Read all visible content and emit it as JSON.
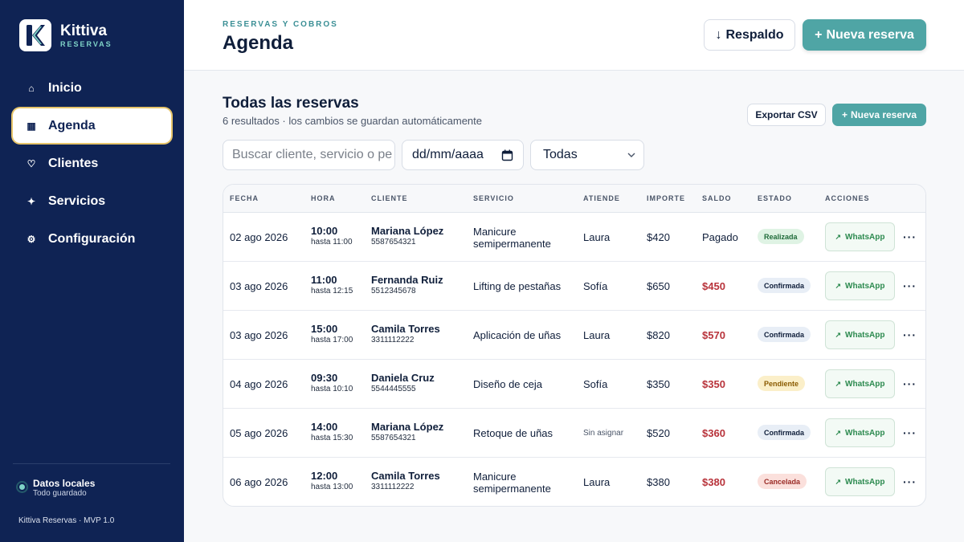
{
  "brand": {
    "name": "Kittiva",
    "sub": "RESERVAS",
    "logo_letter": "K"
  },
  "nav": [
    {
      "label": "Inicio",
      "icon": "home-icon",
      "glyph": "⌂",
      "active": false
    },
    {
      "label": "Agenda",
      "icon": "calendar-grid-icon",
      "glyph": "▦",
      "active": true
    },
    {
      "label": "Clientes",
      "icon": "heart-icon",
      "glyph": "♡",
      "active": false
    },
    {
      "label": "Servicios",
      "icon": "sparkle-icon",
      "glyph": "✦",
      "active": false
    },
    {
      "label": "Configuración",
      "icon": "gear-icon",
      "glyph": "⚙",
      "active": false
    }
  ],
  "local": {
    "title": "Datos locales",
    "sub": "Todo guardado"
  },
  "version": "Kittiva Reservas · MVP 1.0",
  "header": {
    "crumb": "RESERVAS Y COBROS",
    "title": "Agenda",
    "backup_label": "Respaldo",
    "new_label": "Nueva reserva"
  },
  "section": {
    "title": "Todas las reservas",
    "sub": "6 resultados · los cambios se guardan automáticamente",
    "export_label": "Exportar CSV",
    "new_label": "Nueva reserva"
  },
  "filters": {
    "search_placeholder": "Buscar cliente, servicio o pe",
    "date_placeholder": "dd/mm/aaaa",
    "status_value": "Todas"
  },
  "columns": [
    "FECHA",
    "HORA",
    "CLIENTE",
    "SERVICIO",
    "ATIENDE",
    "IMPORTE",
    "SALDO",
    "ESTADO",
    "ACCIONES"
  ],
  "rows": [
    {
      "fecha": "02 ago 2026",
      "hora": "10:00",
      "hasta": "hasta 11:00",
      "cliente": "Mariana López",
      "tel": "5587654321",
      "servicio": "Manicure semipermanente",
      "atiende": "Laura",
      "importe": "$420",
      "saldo": "Pagado",
      "saldo_pendiente": false,
      "estado": "Realizada",
      "estado_tipo": "done",
      "accion": "WhatsApp"
    },
    {
      "fecha": "03 ago 2026",
      "hora": "11:00",
      "hasta": "hasta 12:15",
      "cliente": "Fernanda Ruiz",
      "tel": "5512345678",
      "servicio": "Lifting de pestañas",
      "atiende": "Sofía",
      "importe": "$650",
      "saldo": "$450",
      "saldo_pendiente": true,
      "estado": "Confirmada",
      "estado_tipo": "confirmed",
      "accion": "WhatsApp"
    },
    {
      "fecha": "03 ago 2026",
      "hora": "15:00",
      "hasta": "hasta 17:00",
      "cliente": "Camila Torres",
      "tel": "3311112222",
      "servicio": "Aplicación de uñas",
      "atiende": "Laura",
      "importe": "$820",
      "saldo": "$570",
      "saldo_pendiente": true,
      "estado": "Confirmada",
      "estado_tipo": "confirmed",
      "accion": "WhatsApp"
    },
    {
      "fecha": "04 ago 2026",
      "hora": "09:30",
      "hasta": "hasta 10:10",
      "cliente": "Daniela Cruz",
      "tel": "5544445555",
      "servicio": "Diseño de ceja",
      "atiende": "Sofía",
      "importe": "$350",
      "saldo": "$350",
      "saldo_pendiente": true,
      "estado": "Pendiente",
      "estado_tipo": "pending",
      "accion": "WhatsApp"
    },
    {
      "fecha": "05 ago 2026",
      "hora": "14:00",
      "hasta": "hasta 15:30",
      "cliente": "Mariana López",
      "tel": "5587654321",
      "servicio": "Retoque de uñas",
      "atiende": "Sin asignar",
      "atiende_vacio": true,
      "importe": "$520",
      "saldo": "$360",
      "saldo_pendiente": true,
      "estado": "Confirmada",
      "estado_tipo": "confirmed",
      "accion": "WhatsApp"
    },
    {
      "fecha": "06 ago 2026",
      "hora": "12:00",
      "hasta": "hasta 13:00",
      "cliente": "Camila Torres",
      "tel": "3311112222",
      "servicio": "Manicure semipermanente",
      "atiende": "Laura",
      "importe": "$380",
      "saldo": "$380",
      "saldo_pendiente": true,
      "estado": "Cancelada",
      "estado_tipo": "cancelled",
      "accion": "WhatsApp"
    }
  ],
  "badge_colors": {
    "done": {
      "bg": "#dff3e4",
      "fg": "#1f6b3a"
    },
    "confirmed": {
      "bg": "#e8eef6",
      "fg": "#0f1e3a"
    },
    "pending": {
      "bg": "#fbefc9",
      "fg": "#8a5a00"
    },
    "cancelled": {
      "bg": "#fbe0dc",
      "fg": "#9a2b26"
    }
  },
  "colors": {
    "sidebar": "#0f2354",
    "accent": "#4fa5a5",
    "debt": "#b8333b",
    "whatsapp": "#2c8a4f"
  }
}
